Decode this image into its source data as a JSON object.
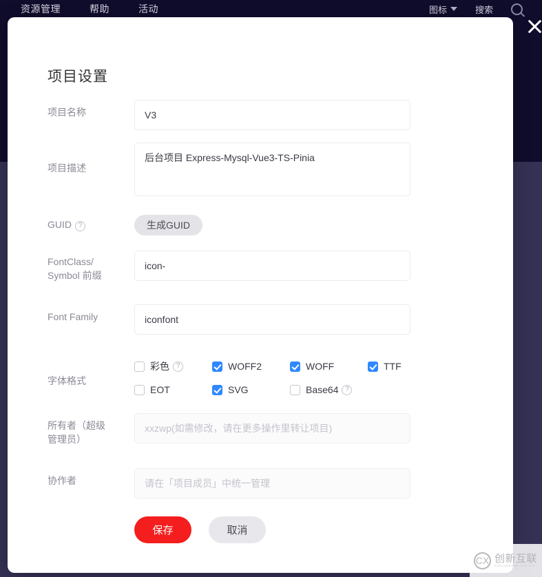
{
  "background": {
    "nav_items": [
      {
        "label": "资源管理"
      },
      {
        "label": "帮助"
      },
      {
        "label": "活动"
      }
    ],
    "right_items": [
      {
        "label": "图标",
        "icon": "chevron-down-icon"
      },
      {
        "label": "搜索"
      }
    ]
  },
  "modal": {
    "title": "项目设置",
    "close_icon": "close-icon",
    "fields": {
      "project_name": {
        "label": "项目名称",
        "value": "V3",
        "placeholder": ""
      },
      "project_desc": {
        "label": "项目描述",
        "value": "后台项目 Express-Mysql-Vue3-TS-Pinia",
        "placeholder": ""
      },
      "guid": {
        "label": "GUID",
        "help_icon": "help-icon",
        "button_label": "生成GUID"
      },
      "prefix": {
        "label_line1": "FontClass/",
        "label_line2": "Symbol 前缀",
        "value": "icon-",
        "placeholder": ""
      },
      "font_family": {
        "label": "Font Family",
        "value": "iconfont",
        "placeholder": ""
      },
      "font_formats": {
        "label": "字体格式",
        "options": [
          {
            "label": "彩色",
            "checked": false,
            "help": true
          },
          {
            "label": "WOFF2",
            "checked": true,
            "help": false
          },
          {
            "label": "WOFF",
            "checked": true,
            "help": false
          },
          {
            "label": "TTF",
            "checked": true,
            "help": false
          },
          {
            "label": "EOT",
            "checked": false,
            "help": false
          },
          {
            "label": "SVG",
            "checked": true,
            "help": false
          },
          {
            "label": "Base64",
            "checked": false,
            "help": true
          }
        ]
      },
      "owner": {
        "label_line1": "所有者（超级",
        "label_line2": "管理员）",
        "value": "",
        "placeholder": "xxzwp(如需修改，请在更多操作里转让项目)"
      },
      "collaborators": {
        "label": "协作者",
        "value": "",
        "placeholder": "请在「项目成员」中统一管理"
      }
    },
    "actions": {
      "save_label": "保存",
      "cancel_label": "取消"
    }
  },
  "watermark": {
    "mark": "CX",
    "name_cn": "创新互联",
    "name_en": "CHUANGXIN HULIAN"
  },
  "colors": {
    "accent_checkbox": "#2f88ff",
    "save_button": "#f41e1e",
    "cancel_button": "#e8e8ec",
    "bg_top": "#100c2c",
    "bg_bottom": "#343154"
  }
}
